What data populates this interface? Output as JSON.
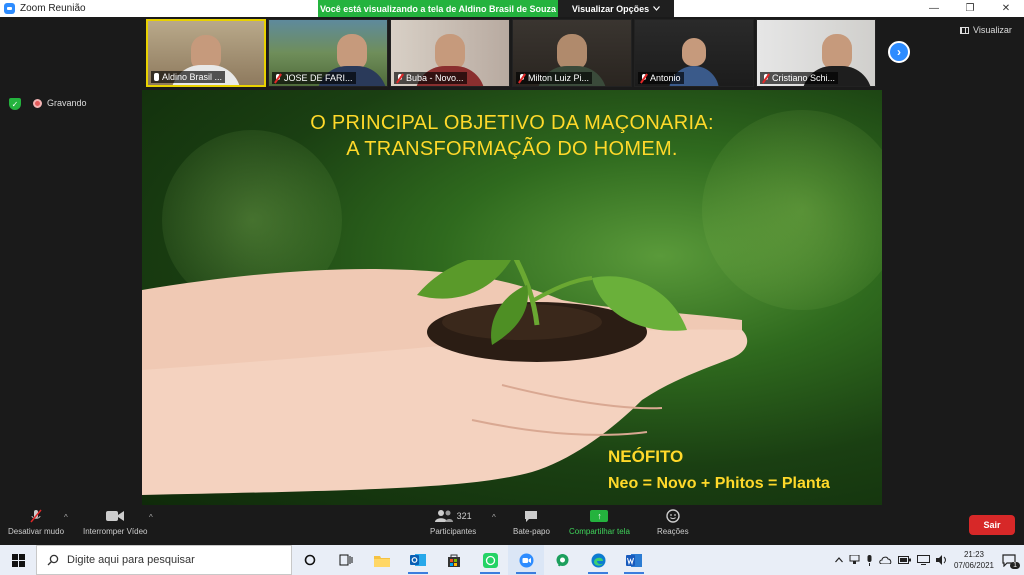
{
  "window": {
    "title": "Zoom Reunião",
    "sharing_banner": "Você está visualizando a tela de Aldino Brasil de Souza",
    "view_options": "Visualizar Opções",
    "minimize": "—",
    "restore": "❐",
    "close": "✕"
  },
  "gallery": {
    "participants": [
      {
        "name": "Aldino Brasil ...",
        "muted": false
      },
      {
        "name": "JOSE DE FARI...",
        "muted": true
      },
      {
        "name": "Buba - Novo...",
        "muted": true
      },
      {
        "name": "Milton Luiz Pi...",
        "muted": true
      },
      {
        "name": "Antonio",
        "muted": true
      },
      {
        "name": "Cristiano Schi...",
        "muted": true
      }
    ],
    "next_icon": "›",
    "view_label": "Visualizar"
  },
  "status": {
    "security_icon": "✓",
    "recording_label": "Gravando"
  },
  "slide": {
    "title_line1": "O PRINCIPAL OBJETIVO DA MAÇONARIA:",
    "title_line2": "A TRANSFORMAÇÃO DO HOMEM.",
    "caption1": "NEÓFITO",
    "caption2": "Neo = Novo + Phitos = Planta"
  },
  "toolbar": {
    "mute_label": "Desativar mudo",
    "video_label": "Interromper Vídeo",
    "participants_label": "Participantes",
    "participants_count": "321",
    "chat_label": "Bate-papo",
    "share_label": "Compartilhar tela",
    "reactions_label": "Reações",
    "leave_label": "Sair",
    "caret": "^",
    "share_arrow": "↑"
  },
  "taskbar": {
    "search_placeholder": "Digite aqui para pesquisar",
    "time": "21:23",
    "date": "07/06/2021",
    "notification_count": "1"
  },
  "colors": {
    "zoom_blue": "#2d8cff",
    "banner_green": "#24b33e",
    "leave_red": "#d72828",
    "slide_text": "#ffd92a"
  }
}
